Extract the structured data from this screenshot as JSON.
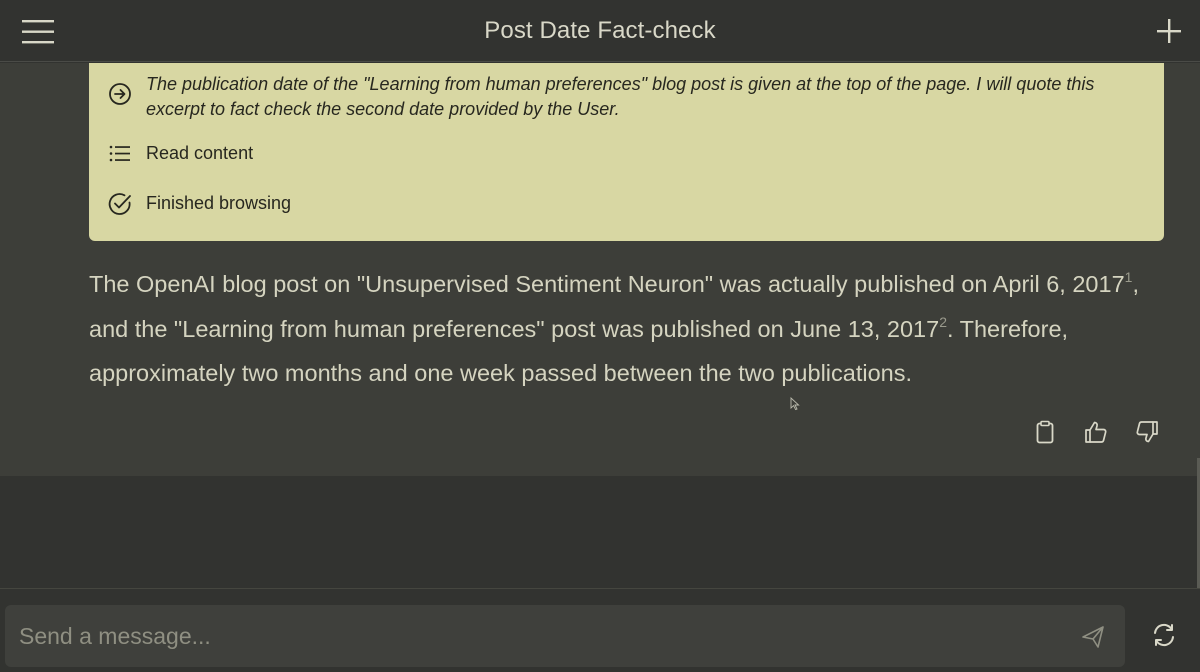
{
  "header": {
    "title": "Post Date Fact-check",
    "menu_icon": "hamburger-menu-icon",
    "new_chat_icon": "plus-icon"
  },
  "browsing": {
    "steps": [
      {
        "icon": "arrow-circle-right-icon",
        "text": "The publication date of the \"Learning from human preferences\" blog post is given at the top of the page. I will quote this excerpt to fact check the second date provided by the User."
      },
      {
        "icon": "list-icon",
        "text": "Read content"
      },
      {
        "icon": "check-circle-icon",
        "text": "Finished browsing"
      }
    ]
  },
  "answer": {
    "part1": "The OpenAI blog post on \"Unsupervised Sentiment Neuron\" was actually published on April 6, 2017",
    "cite1": "1",
    "part2": ", and the \"Learning from human preferences\" post was published on June 13, 2017",
    "cite2": "2",
    "part3": ". Therefore, approximately two months and one week passed between the two publications."
  },
  "actions": {
    "copy_icon": "clipboard-icon",
    "like_icon": "thumbs-up-icon",
    "dislike_icon": "thumbs-down-icon"
  },
  "composer": {
    "placeholder": "Send a message...",
    "value": "",
    "send_icon": "send-icon",
    "regenerate_icon": "regenerate-icon"
  },
  "colors": {
    "background": "#323330",
    "message_background": "#3d3e39",
    "browse_box": "#d8d7a3",
    "text": "#d5d4c0"
  }
}
